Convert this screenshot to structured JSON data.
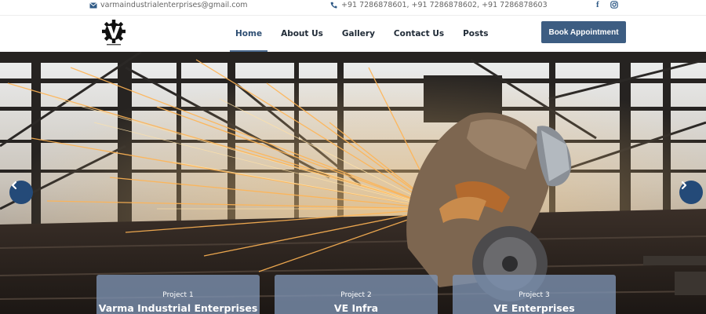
{
  "topbar": {
    "email": "varmaindustrialenterprises@gmail.com",
    "phones": "+91 7286878601, +91 7286878602, +91 7286878603",
    "social": [
      "facebook-icon",
      "instagram-icon"
    ]
  },
  "nav": {
    "items": [
      {
        "label": "Home",
        "active": true
      },
      {
        "label": "About Us"
      },
      {
        "label": "Gallery"
      },
      {
        "label": "Contact Us"
      },
      {
        "label": "Posts"
      }
    ],
    "cta": "Book Appointment"
  },
  "hero": {
    "arrows": [
      "chevron-left-icon",
      "chevron-right-icon"
    ]
  },
  "projects": [
    {
      "label": "Project 1",
      "title": "Varma Industrial Enterprises"
    },
    {
      "label": "Project 2",
      "title": "VE Infra"
    },
    {
      "label": "Project 3",
      "title": "VE Enterprises"
    }
  ],
  "colors": {
    "accent": "#3d5d82",
    "arrow": "#244a78"
  }
}
